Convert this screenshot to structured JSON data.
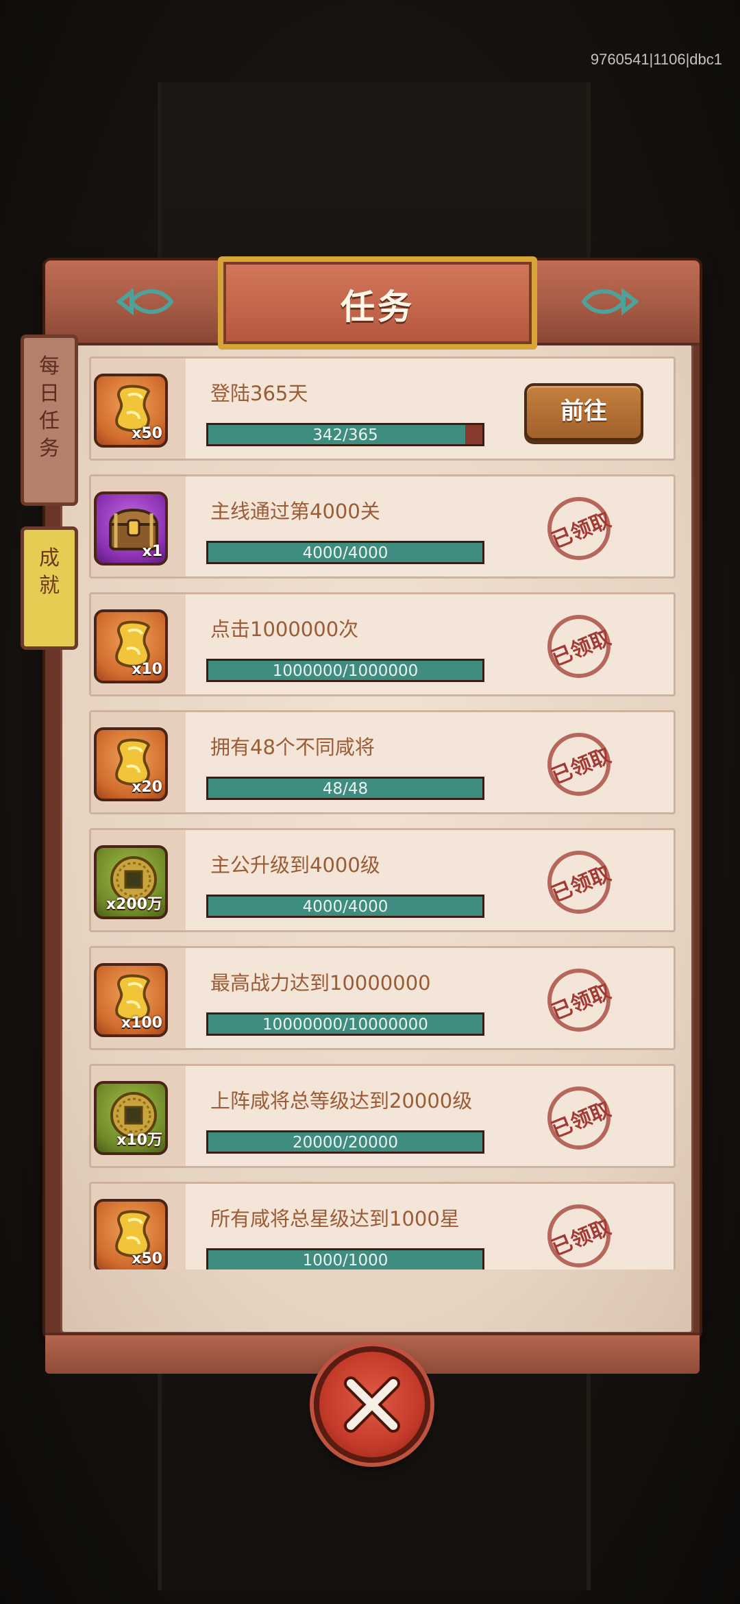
{
  "debug_id": "9760541|1106|dbc1",
  "title": "任务",
  "side_tabs": [
    {
      "label_chars": [
        "每",
        "日",
        "任",
        "务"
      ],
      "active": false
    },
    {
      "label_chars": [
        "成",
        "就"
      ],
      "active": true
    }
  ],
  "tasks": [
    {
      "name": "登陆365天",
      "progress": "342/365",
      "fraction": 0.937,
      "reward_icon": "gold-ingot-icon",
      "reward_color": "orange",
      "qty": "x50",
      "status": "go",
      "action_label": "前往"
    },
    {
      "name": "主线通过第4000关",
      "progress": "4000/4000",
      "fraction": 1,
      "reward_icon": "treasure-chest-icon",
      "reward_color": "purple",
      "qty": "x1",
      "status": "claimed",
      "action_label": "已领取"
    },
    {
      "name": "点击1000000次",
      "progress": "1000000/1000000",
      "fraction": 1,
      "reward_icon": "gold-ingot-icon",
      "reward_color": "orange",
      "qty": "x10",
      "status": "claimed",
      "action_label": "已领取"
    },
    {
      "name": "拥有48个不同咸将",
      "progress": "48/48",
      "fraction": 1,
      "reward_icon": "gold-ingot-icon",
      "reward_color": "orange",
      "qty": "x20",
      "status": "claimed",
      "action_label": "已领取"
    },
    {
      "name": "主公升级到4000级",
      "progress": "4000/4000",
      "fraction": 1,
      "reward_icon": "copper-coin-icon",
      "reward_color": "green",
      "qty": "x200万",
      "status": "claimed",
      "action_label": "已领取"
    },
    {
      "name": "最高战力达到10000000",
      "progress": "10000000/10000000",
      "fraction": 1,
      "reward_icon": "gold-ingot-icon",
      "reward_color": "orange",
      "qty": "x100",
      "status": "claimed",
      "action_label": "已领取"
    },
    {
      "name": "上阵咸将总等级达到20000级",
      "progress": "20000/20000",
      "fraction": 1,
      "reward_icon": "copper-coin-icon",
      "reward_color": "green",
      "qty": "x10万",
      "status": "claimed",
      "action_label": "已领取"
    },
    {
      "name": "所有咸将总星级达到1000星",
      "progress": "1000/1000",
      "fraction": 1,
      "reward_icon": "gold-ingot-icon",
      "reward_color": "orange",
      "qty": "x50",
      "status": "claimed",
      "action_label": "已领取"
    }
  ],
  "colors": {
    "bar_fill": "#3f8c80",
    "bar_empty": "#8a3a2c",
    "stamp": "#a23a33"
  }
}
